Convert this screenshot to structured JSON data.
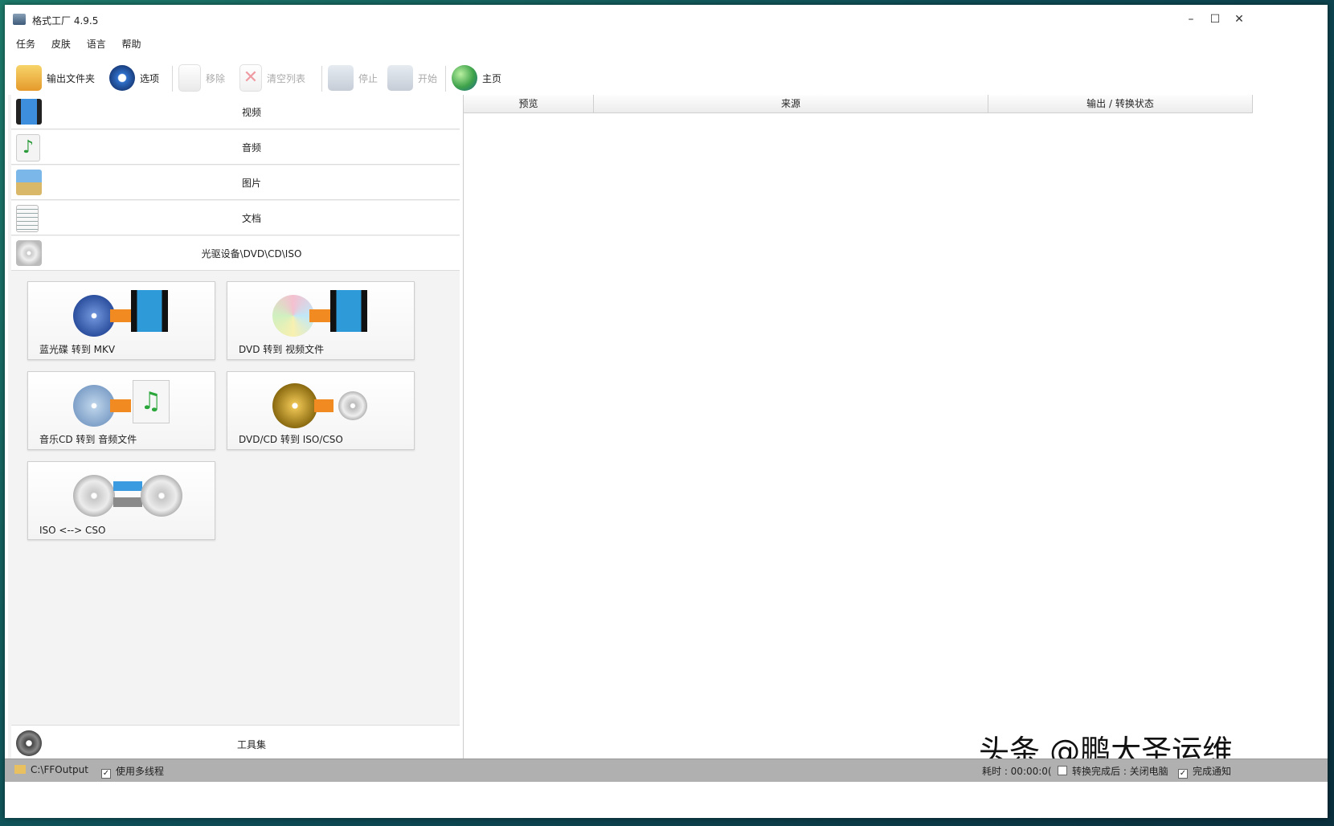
{
  "window": {
    "title": "格式工厂 4.9.5",
    "minimize": "–",
    "maximize": "☐",
    "close": "✕"
  },
  "menu": [
    "任务",
    "皮肤",
    "语言",
    "帮助"
  ],
  "toolbar": {
    "output_folder": "输出文件夹",
    "options": "选项",
    "remove": "移除",
    "clear_list": "清空列表",
    "stop": "停止",
    "start": "开始",
    "home": "主页"
  },
  "categories": [
    "视频",
    "音频",
    "图片",
    "文档",
    "光驱设备\\DVD\\CD\\ISO"
  ],
  "tiles": [
    "蓝光碟 转到 MKV",
    "DVD 转到 视频文件",
    "音乐CD 转到 音频文件",
    "DVD/CD 转到 ISO/CSO",
    "ISO <--> CSO"
  ],
  "tools": "工具集",
  "table_headers": [
    "预览",
    "来源",
    "输出 / 转换状态"
  ],
  "status": {
    "path": "C:\\FFOutput",
    "multithread": "使用多线程",
    "elapsed": "耗时 : 00:00:0(",
    "after_convert": "转换完成后 : 关闭电脑",
    "notify": "完成通知"
  },
  "watermark": "头条 @鹏大圣运维",
  "colors": {
    "accent": "#3a7bd5",
    "status_bg": "#b0b0b0"
  }
}
